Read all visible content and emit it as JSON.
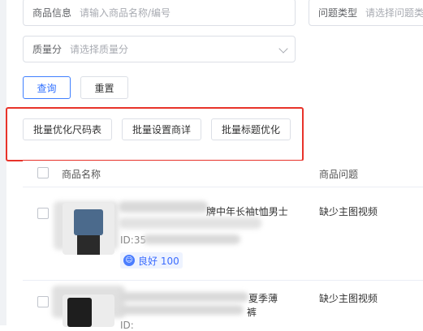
{
  "filters": {
    "product_info": {
      "label": "商品信息",
      "placeholder": "请输入商品名称/编号"
    },
    "issue_type": {
      "label": "问题类型",
      "placeholder": "请选择问题类"
    },
    "quality_score": {
      "label": "质量分",
      "placeholder": "请选择质量分"
    }
  },
  "actions": {
    "query": "查询",
    "reset": "重置"
  },
  "batch": {
    "size_chart": "批量优化尺码表",
    "details": "批量设置商详",
    "title": "批量标题优化"
  },
  "table": {
    "columns": {
      "name": "商品名称",
      "issue": "商品问题"
    },
    "rows": [
      {
        "title_line1": "牌中年长袖t恤男士",
        "id_label": "ID:35",
        "score": "良好 100",
        "issue": "缺少主图视频"
      },
      {
        "title_line1": "夏季薄",
        "title_line2": "裤",
        "id_label": "ID:",
        "issue": "缺少主图视频"
      }
    ]
  },
  "colors": {
    "primary": "#2f6fff",
    "highlight": "#e8332a"
  }
}
